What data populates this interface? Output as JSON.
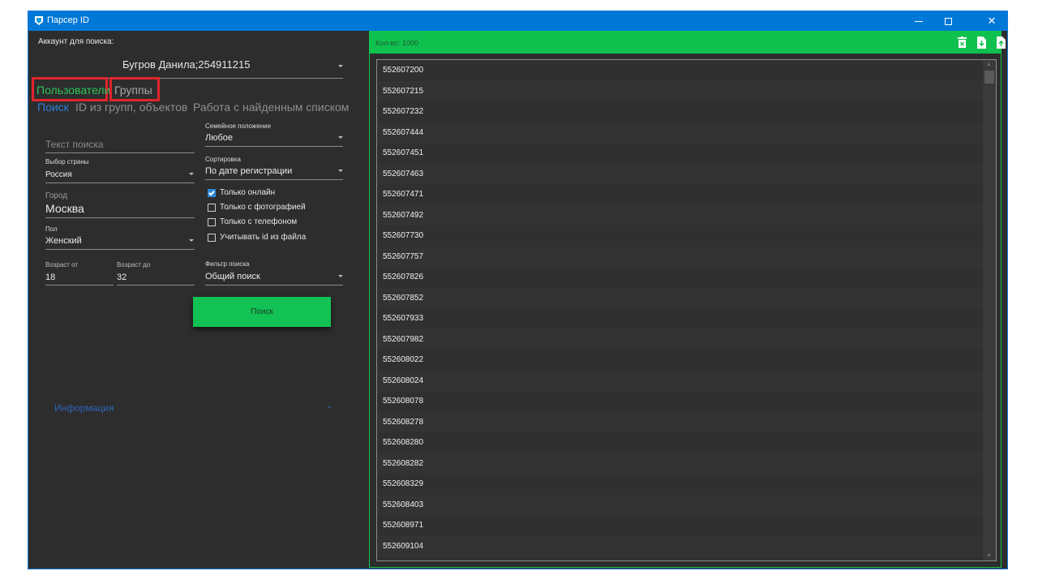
{
  "window": {
    "title": "Парсер ID"
  },
  "account": {
    "label": "Аккаунт для поиска:",
    "value": "Бугров Данила;254911215"
  },
  "main_tabs": {
    "users": "Пользователи",
    "groups": "Группы"
  },
  "sub_tabs": {
    "search": "Поиск",
    "id_groups": "ID из групп, объектов",
    "work_list": "Работа с найденным списком"
  },
  "form": {
    "search_text_placeholder": "Текст поиска",
    "country_label": "Выбор страны",
    "country_value": "Россия",
    "city_label": "Город",
    "city_value": "Москва",
    "gender_label": "Пол",
    "gender_value": "Женский",
    "age_from_label": "Возраст от",
    "age_from_value": "18",
    "age_to_label": "Возраст до",
    "age_to_value": "32",
    "marital_label": "Семейное положение",
    "marital_value": "Любое",
    "sort_label": "Сортировка",
    "sort_value": "По дате регистрации",
    "checkbox_online": "Только онлайн",
    "checkbox_photo": "Только с фотографией",
    "checkbox_phone": "Только с телефоном",
    "checkbox_file": "Учитывать id из файла",
    "filter_label": "Фильтр поиска",
    "filter_value": "Общий поиск",
    "search_button": "Поиск"
  },
  "info_label": "Информация",
  "results": {
    "count_label": "Кол-во: 1000",
    "ids": [
      "552607200",
      "552607215",
      "552607232",
      "552607444",
      "552607451",
      "552607463",
      "552607471",
      "552607492",
      "552607730",
      "552607757",
      "552607826",
      "552607852",
      "552607933",
      "552607982",
      "552608022",
      "552608024",
      "552608078",
      "552608278",
      "552608280",
      "552608282",
      "552608329",
      "552608403",
      "552608971",
      "552609104"
    ]
  },
  "colors": {
    "accent_green": "#12c254",
    "title_blue": "#0078d7",
    "highlight_red": "#e0252b",
    "link_blue": "#2f7ed8"
  }
}
